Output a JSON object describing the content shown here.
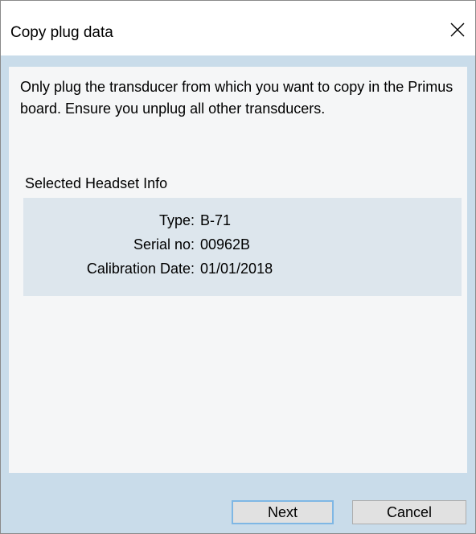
{
  "window": {
    "title": "Copy plug data"
  },
  "instructions": "Only plug the transducer from which you want to copy in the Primus board. Ensure you unplug all other transducers.",
  "headset_info": {
    "section_label": "Selected Headset Info",
    "rows": [
      {
        "label": "Type:",
        "value": "B-71"
      },
      {
        "label": "Serial no:",
        "value": "00962B"
      },
      {
        "label": "Calibration Date:",
        "value": "01/01/2018"
      }
    ]
  },
  "buttons": {
    "next_label": "Next",
    "cancel_label": "Cancel"
  },
  "icons": {
    "close": "close-icon"
  }
}
